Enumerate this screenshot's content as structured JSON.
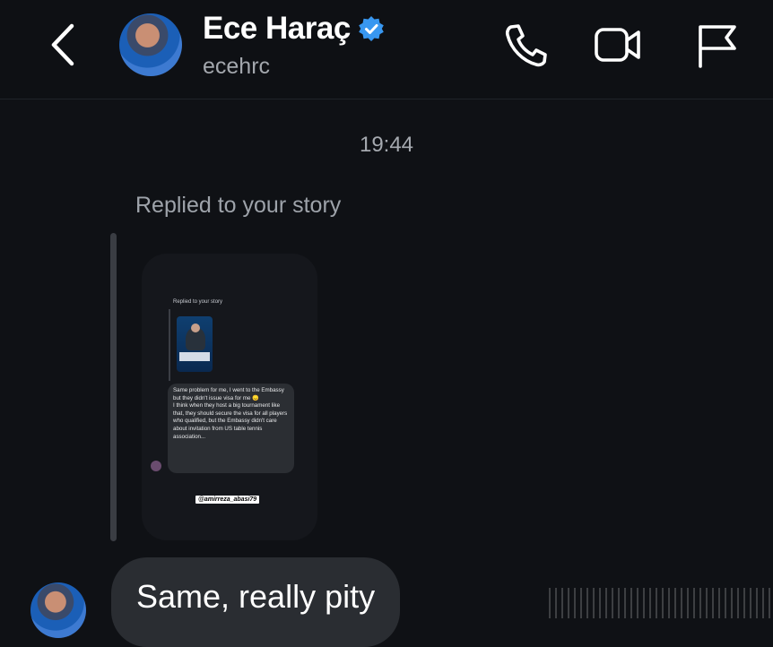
{
  "header": {
    "back_icon": "chevron-left-icon",
    "display_name": "Ece Haraç",
    "verified": true,
    "verified_color": "#3897f0",
    "username": "ecehrc",
    "icons": [
      "phone-icon",
      "video-camera-icon",
      "flag-icon"
    ]
  },
  "conversation": {
    "timestamp": "19:44",
    "reply_context": "Replied to your story",
    "shared_story": {
      "replied_label": "Replied to your story",
      "message_text": "Same problem for me, I went to the Embassy but they didn't issue visa for me 😞\nI think when they host a big tournament like that, they should secure the visa for all players who qualified, but the Embassy didn't care about invitation from US table tennis association...",
      "mention": "@amirreza_abasi79"
    },
    "message": "Same, really pity"
  },
  "colors": {
    "background": "#0f1115",
    "bubble": "#2a2d32",
    "secondary_text": "#a3a7ad"
  }
}
